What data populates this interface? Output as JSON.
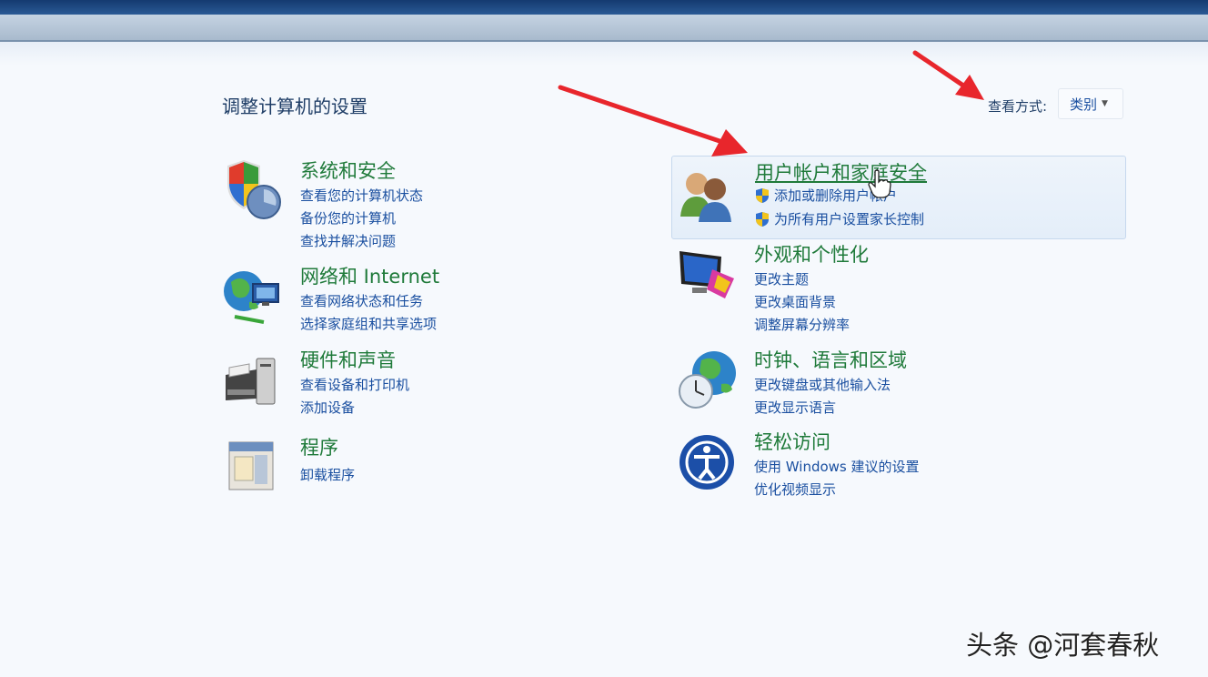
{
  "page": {
    "title": "调整计算机的设置",
    "view_by_label": "查看方式:",
    "view_by_value": "类别"
  },
  "categories": [
    {
      "heading": "系统和安全",
      "links": [
        "查看您的计算机状态",
        "备份您的计算机",
        "查找并解决问题"
      ],
      "icon": "system-security-icon"
    },
    {
      "heading": "网络和 Internet",
      "links": [
        "查看网络状态和任务",
        "选择家庭组和共享选项"
      ],
      "icon": "network-icon"
    },
    {
      "heading": "硬件和声音",
      "links": [
        "查看设备和打印机",
        "添加设备"
      ],
      "icon": "printer-icon"
    },
    {
      "heading": "程序",
      "links": [
        "卸载程序"
      ],
      "icon": "programs-icon"
    },
    {
      "heading": "用户帐户和家庭安全",
      "links": [
        "添加或删除用户帐户",
        "为所有用户设置家长控制"
      ],
      "icon": "users-icon"
    },
    {
      "heading": "外观和个性化",
      "links": [
        "更改主题",
        "更改桌面背景",
        "调整屏幕分辨率"
      ],
      "icon": "monitor-icon"
    },
    {
      "heading": "时钟、语言和区域",
      "links": [
        "更改键盘或其他输入法",
        "更改显示语言"
      ],
      "icon": "globe-clock-icon"
    },
    {
      "heading": "轻松访问",
      "links": [
        "使用 Windows 建议的设置",
        "优化视频显示"
      ],
      "icon": "ease-of-access-icon"
    }
  ],
  "watermark": "头条 @河套春秋",
  "colors": {
    "heading_green": "#1f7a3a",
    "link_blue": "#1a4fa0",
    "arrow_red": "#e8262c"
  }
}
